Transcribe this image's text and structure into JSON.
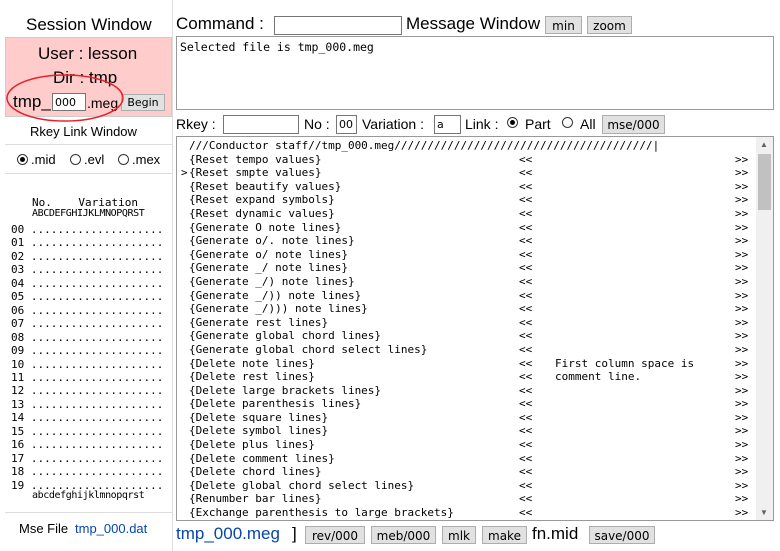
{
  "session": {
    "title": "Session Window",
    "user_line": "User : lesson",
    "dir_line": "Dir : tmp",
    "file_prefix": "tmp_",
    "file_number": "000",
    "file_suffix": ".meg",
    "begin_label": "Begin"
  },
  "rkey_panel": {
    "title": "Rkey Link Window",
    "radios": [
      {
        "label": ".mid",
        "checked": true
      },
      {
        "label": ".evl",
        "checked": false
      },
      {
        "label": ".mex",
        "checked": false
      }
    ],
    "header_line1": "No.    Variation",
    "header_line2": "ABCDEFGHIJKLMNOPQRST",
    "rows": [
      "00 ....................",
      "01 ....................",
      "02 ....................",
      "03 ....................",
      "04 ....................",
      "05 ....................",
      "06 ....................",
      "07 ....................",
      "08 ....................",
      "09 ....................",
      "10 ....................",
      "11 ....................",
      "12 ....................",
      "13 ....................",
      "14 ....................",
      "15 ....................",
      "16 ....................",
      "17 ....................",
      "18 ....................",
      "19 ...................."
    ],
    "footer_line": "abcdefghijklmnopqrst",
    "mse_label": "Mse File",
    "mse_file": "tmp_000.dat"
  },
  "command": {
    "label": "Command :",
    "value": "",
    "message_label": "Message Window",
    "min_label": "min",
    "zoom_label": "zoom"
  },
  "message": {
    "text": "Selected file is tmp_000.meg"
  },
  "rkey_bar": {
    "rkey_label": "Rkey :",
    "rkey_value": "",
    "no_label": "No :",
    "no_value": "00",
    "variation_label": "Variation :",
    "variation_value": "a",
    "link_label": "Link :",
    "part_label": "Part",
    "all_label": "All",
    "mse_button": "mse/000"
  },
  "list": {
    "header": "///Conductor staff//tmp_000.meg///////////////////////////////////////|",
    "items": [
      {
        "marker": " ",
        "text": "{Reset tempo values}",
        "left": "<<",
        "note": "",
        "right": ">>"
      },
      {
        "marker": ">",
        "text": "{Reset smpte values}",
        "left": "<<",
        "note": "",
        "right": ">>"
      },
      {
        "marker": " ",
        "text": "{Reset beautify values}",
        "left": "<<",
        "note": "",
        "right": ">>"
      },
      {
        "marker": " ",
        "text": "{Reset expand symbols}",
        "left": "<<",
        "note": "",
        "right": ">>"
      },
      {
        "marker": " ",
        "text": "{Reset dynamic values}",
        "left": "<<",
        "note": "",
        "right": ">>"
      },
      {
        "marker": " ",
        "text": "{Generate O note lines}",
        "left": "<<",
        "note": "",
        "right": ">>"
      },
      {
        "marker": " ",
        "text": "{Generate o/. note lines}",
        "left": "<<",
        "note": "",
        "right": ">>"
      },
      {
        "marker": " ",
        "text": "{Generate o/ note lines}",
        "left": "<<",
        "note": "",
        "right": ">>"
      },
      {
        "marker": " ",
        "text": "{Generate _/ note lines}",
        "left": "<<",
        "note": "",
        "right": ">>"
      },
      {
        "marker": " ",
        "text": "{Generate _/) note lines}",
        "left": "<<",
        "note": "",
        "right": ">>"
      },
      {
        "marker": " ",
        "text": "{Generate _/)) note lines}",
        "left": "<<",
        "note": "",
        "right": ">>"
      },
      {
        "marker": " ",
        "text": "{Generate _/))) note lines}",
        "left": "<<",
        "note": "",
        "right": ">>"
      },
      {
        "marker": " ",
        "text": "{Generate rest lines}",
        "left": "<<",
        "note": "",
        "right": ">>"
      },
      {
        "marker": " ",
        "text": "{Generate global chord lines}",
        "left": "<<",
        "note": "",
        "right": ">>"
      },
      {
        "marker": " ",
        "text": "{Generate global chord select lines}",
        "left": "<<",
        "note": "",
        "right": ">>"
      },
      {
        "marker": " ",
        "text": "{Delete note lines}",
        "left": "<<",
        "note": "First column space is",
        "right": ">>"
      },
      {
        "marker": " ",
        "text": "{Delete rest lines}",
        "left": "<<",
        "note": "comment line.",
        "right": ">>"
      },
      {
        "marker": " ",
        "text": "{Delete large brackets lines}",
        "left": "<<",
        "note": "",
        "right": ">>"
      },
      {
        "marker": " ",
        "text": "{Delete parenthesis lines}",
        "left": "<<",
        "note": "",
        "right": ">>"
      },
      {
        "marker": " ",
        "text": "{Delete square lines}",
        "left": "<<",
        "note": "",
        "right": ">>"
      },
      {
        "marker": " ",
        "text": "{Delete symbol lines}",
        "left": "<<",
        "note": "",
        "right": ">>"
      },
      {
        "marker": " ",
        "text": "{Delete plus lines}",
        "left": "<<",
        "note": "",
        "right": ">>"
      },
      {
        "marker": " ",
        "text": "{Delete comment lines}",
        "left": "<<",
        "note": "",
        "right": ">>"
      },
      {
        "marker": " ",
        "text": "{Delete chord lines}",
        "left": "<<",
        "note": "",
        "right": ">>"
      },
      {
        "marker": " ",
        "text": "{Delete global chord select lines}",
        "left": "<<",
        "note": "",
        "right": ">>"
      },
      {
        "marker": " ",
        "text": "{Renumber bar lines}",
        "left": "<<",
        "note": "",
        "right": ">>"
      },
      {
        "marker": " ",
        "text": "{Exchange parenthesis to large brackets}",
        "left": "<<",
        "note": "",
        "right": ">>"
      }
    ]
  },
  "bottom": {
    "filename": "tmp_000.meg",
    "bracket": "]",
    "rev_label": "rev/000",
    "meb_label": "meb/000",
    "mlk_label": "mlk",
    "make_label": "make",
    "fn_label": "fn.mid",
    "save_label": "save/000"
  },
  "colors": {
    "session_bg": "#ffcccc",
    "link_blue": "#0645ad",
    "circle_red": "#e8202a"
  }
}
